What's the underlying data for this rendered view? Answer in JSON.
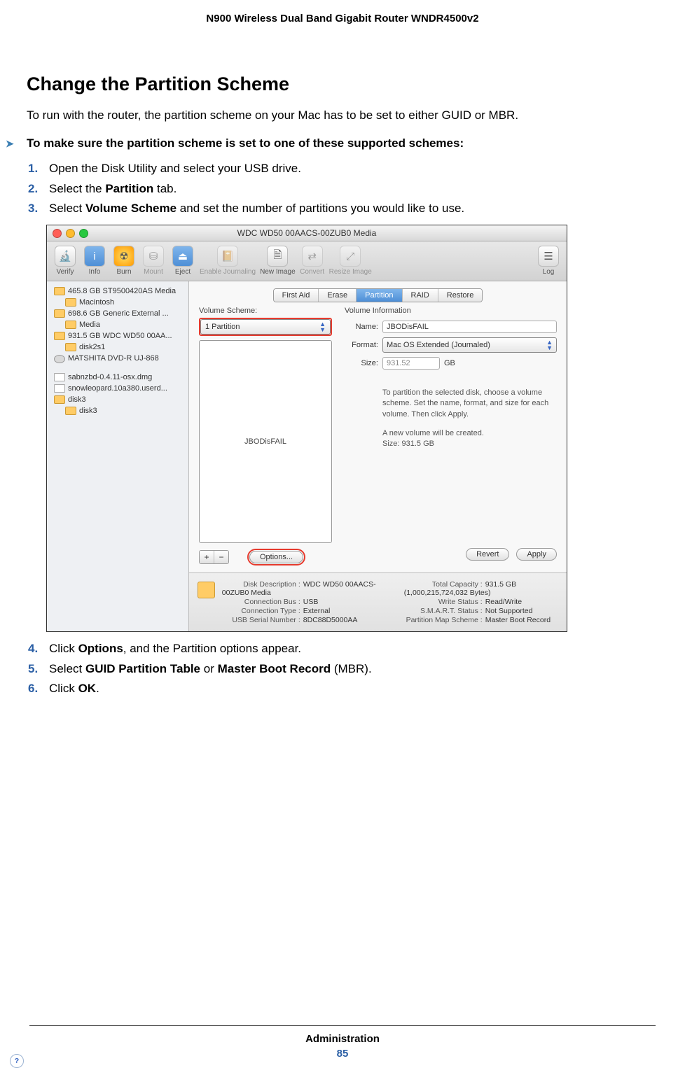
{
  "doc": {
    "running_head": "N900 Wireless Dual Band Gigabit Router WNDR4500v2",
    "heading": "Change the Partition Scheme",
    "intro": "To run with the router, the partition scheme on your Mac has to be set to either GUID or MBR.",
    "task": "To make sure the partition scheme is set to one of these supported schemes:",
    "steps": {
      "s1": "Open the Disk Utility and select your USB drive.",
      "s2a": "Select the ",
      "s2b": "Partition",
      "s2c": " tab.",
      "s3a": "Select ",
      "s3b": "Volume Scheme",
      "s3c": " and set the number of partitions you would like to use.",
      "s4a": "Click ",
      "s4b": "Options",
      "s4c": ", and the Partition options appear.",
      "s5a": "Select ",
      "s5b": "GUID Partition Table",
      "s5c": " or ",
      "s5d": "Master Boot Record",
      "s5e": " (MBR).",
      "s6a": "Click ",
      "s6b": "OK",
      "s6c": "."
    },
    "footer_section": "Administration",
    "footer_page": "85"
  },
  "mac": {
    "title": "WDC WD50 00AACS-00ZUB0 Media",
    "toolbar": {
      "verify": "Verify",
      "info": "Info",
      "burn": "Burn",
      "mount": "Mount",
      "eject": "Eject",
      "enable_journaling": "Enable Journaling",
      "new_image": "New Image",
      "convert": "Convert",
      "resize": "Resize Image",
      "log": "Log"
    },
    "sidebar": {
      "d0": "465.8 GB ST9500420AS Media",
      "d0a": "Macintosh",
      "d1": "698.6 GB Generic External ...",
      "d1a": "Media",
      "d2": "931.5 GB WDC WD50 00AA...",
      "d2a": "disk2s1",
      "d3": "MATSHITA DVD-R UJ-868",
      "f0": "sabnzbd-0.4.11-osx.dmg",
      "f1": "snowleopard.10a380.userd...",
      "d4": "disk3",
      "d4a": "disk3"
    },
    "tabs": {
      "first_aid": "First Aid",
      "erase": "Erase",
      "partition": "Partition",
      "raid": "RAID",
      "restore": "Restore"
    },
    "left": {
      "label": "Volume Scheme:",
      "scheme": "1 Partition",
      "vol_name": "JBODisFAIL",
      "options": "Options...",
      "plus": "+",
      "minus": "−"
    },
    "right": {
      "title": "Volume Information",
      "name_label": "Name:",
      "name_value": "JBODisFAIL",
      "format_label": "Format:",
      "format_value": "Mac OS Extended (Journaled)",
      "size_label": "Size:",
      "size_value": "931.52",
      "size_unit": "GB",
      "hint1": "To partition the selected disk, choose a volume scheme. Set the name, format, and size for each volume. Then click Apply.",
      "hint2a": "A new volume will be created.",
      "hint2b": "Size: 931.5 GB",
      "revert": "Revert",
      "apply": "Apply"
    },
    "info": {
      "l1": "Disk Description :",
      "v1": "WDC WD50 00AACS-00ZUB0 Media",
      "l2": "Connection Bus :",
      "v2": "USB",
      "l3": "Connection Type :",
      "v3": "External",
      "l4": "USB Serial Number :",
      "v4": "8DC88D5000AA",
      "r1": "Total Capacity :",
      "rv1": "931.5 GB (1,000,215,724,032 Bytes)",
      "r2": "Write Status :",
      "rv2": "Read/Write",
      "r3": "S.M.A.R.T. Status :",
      "rv3": "Not Supported",
      "r4": "Partition Map Scheme :",
      "rv4": "Master Boot Record"
    }
  }
}
